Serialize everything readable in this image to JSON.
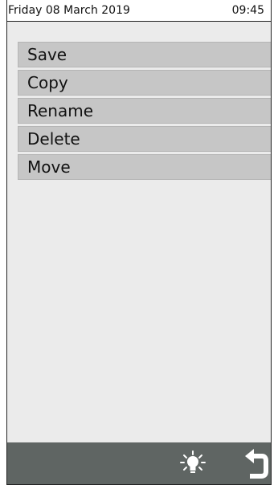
{
  "status": {
    "date": "Friday 08 March 2019",
    "time": "09:45"
  },
  "menu": [
    {
      "label": "Save"
    },
    {
      "label": "Copy"
    },
    {
      "label": "Rename"
    },
    {
      "label": "Delete"
    },
    {
      "label": "Move"
    }
  ],
  "toolbar": {
    "icons": [
      "lightbulb-icon",
      "back-arrow-icon"
    ]
  },
  "colors": {
    "menu_bg": "#c6c6c6",
    "screen_bg": "#ebebeb",
    "toolbar_bg": "#5f6563"
  }
}
